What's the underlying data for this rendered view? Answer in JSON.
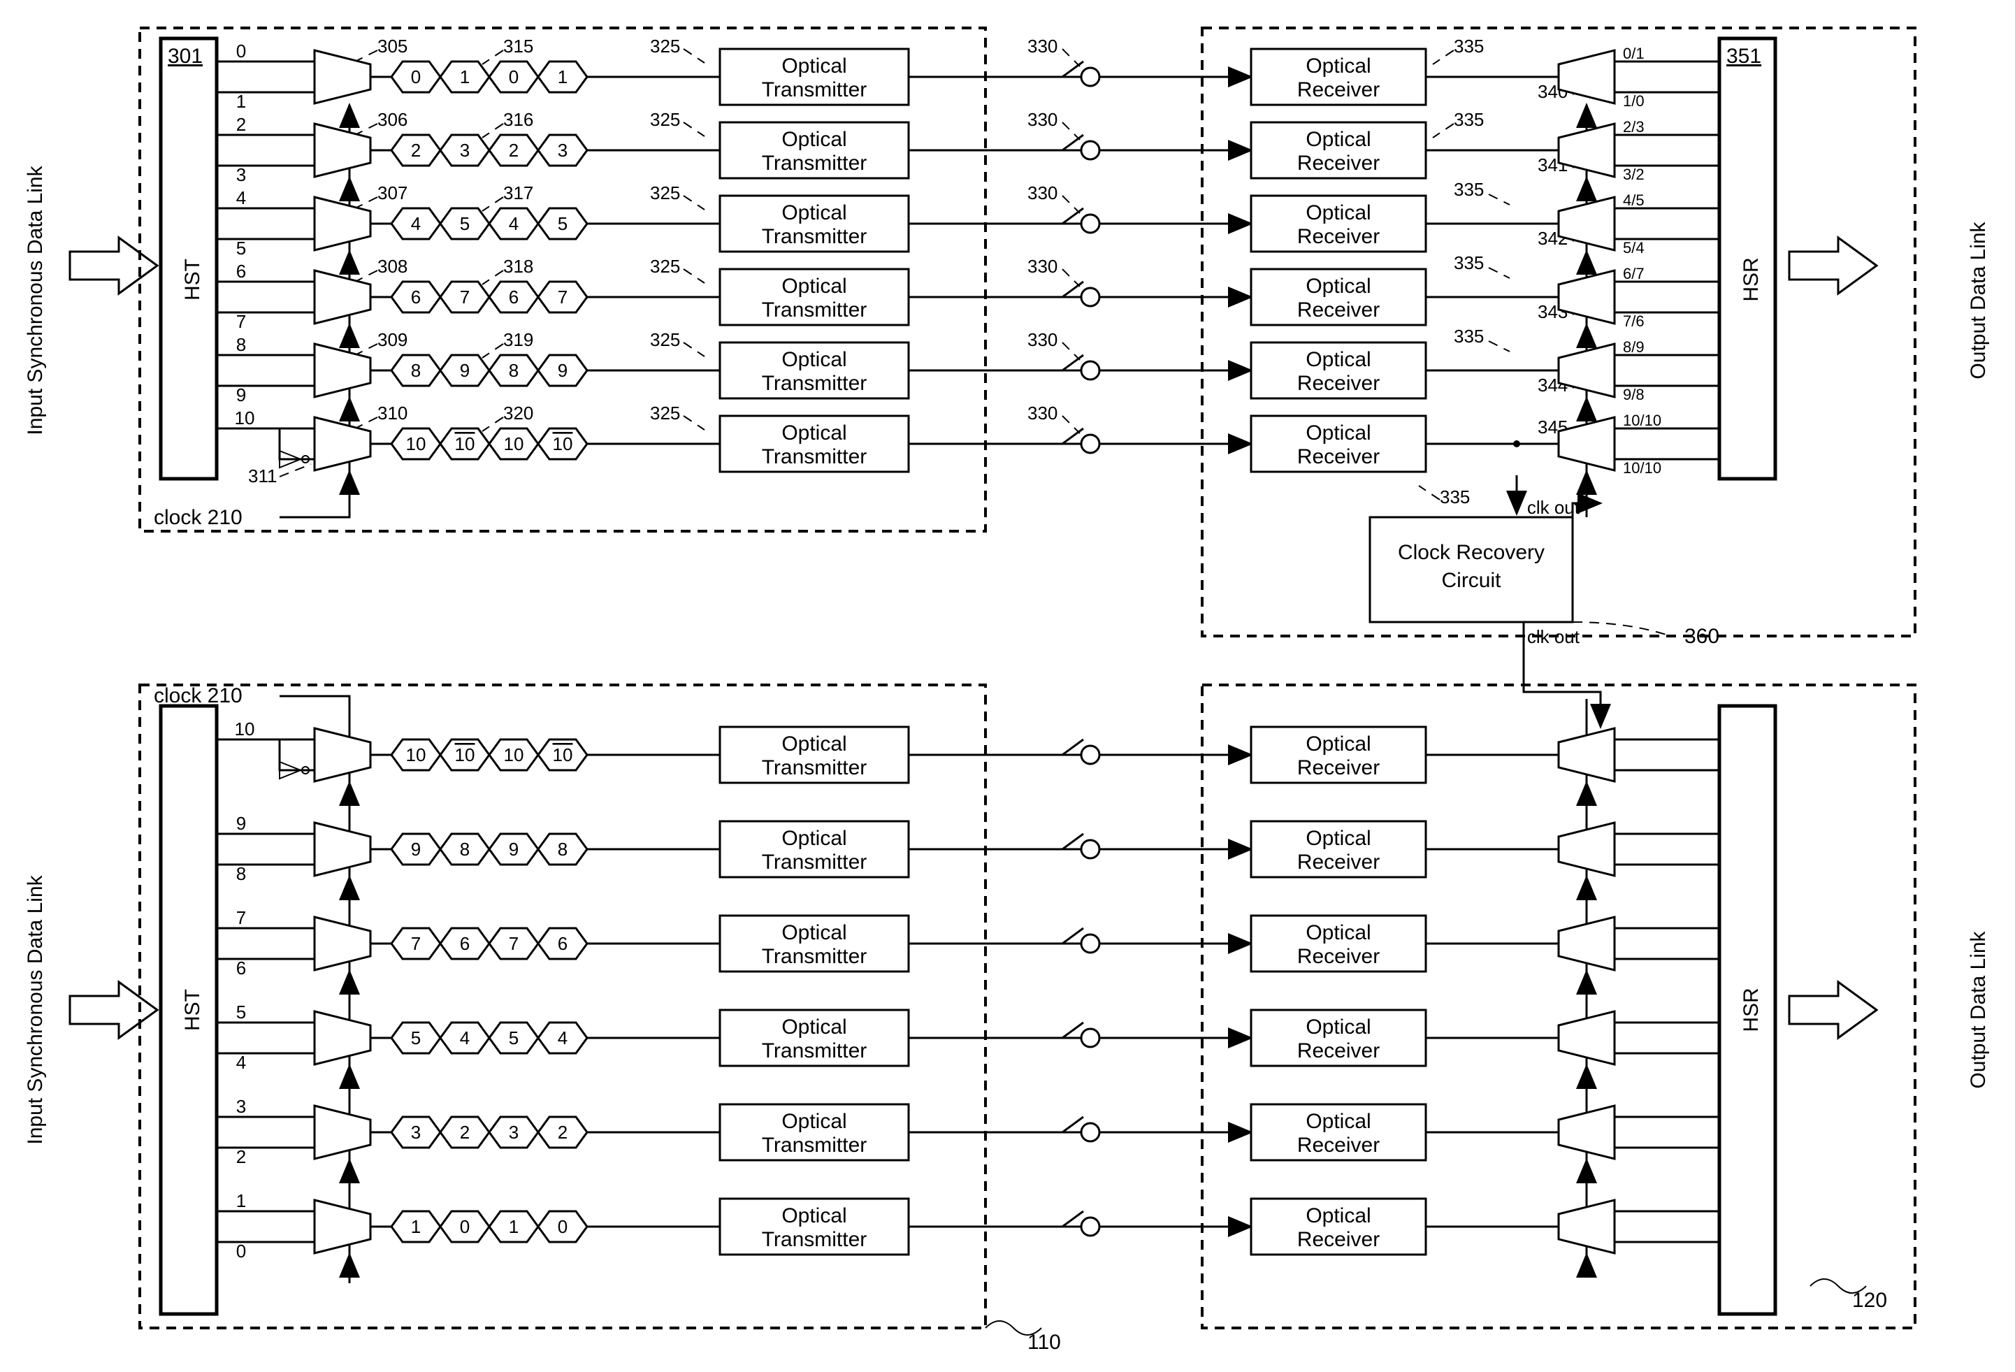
{
  "labels": {
    "input_link": "Input Synchronous Data Link",
    "output_link": "Output Data Link",
    "hst": "HST",
    "hsr": "HSR",
    "opt_tx": "Optical",
    "opt_tx2": "Transmitter",
    "opt_rx": "Optical",
    "opt_rx2": "Receiver",
    "clock": "clock 210",
    "clock_recovery1": "Clock Recovery",
    "clock_recovery2": "Circuit",
    "clk_out": "clk out"
  },
  "refs": {
    "r301": "301",
    "r351": "351",
    "r305": "305",
    "r306": "306",
    "r307": "307",
    "r308": "308",
    "r309": "309",
    "r310": "310",
    "r311": "311",
    "r315": "315",
    "r316": "316",
    "r317": "317",
    "r318": "318",
    "r319": "319",
    "r320": "320",
    "r325": "325",
    "r330": "330",
    "r335": "335",
    "r340": "340",
    "r341": "341",
    "r342": "342",
    "r343": "343",
    "r344": "344",
    "r345": "345",
    "r360": "360",
    "r110": "110",
    "r120": "120"
  },
  "channels_top": [
    {
      "in": [
        "0",
        "1"
      ],
      "hex": [
        "0",
        "1",
        "0",
        "1"
      ],
      "out": [
        "0/1",
        "1/0"
      ]
    },
    {
      "in": [
        "2",
        "3"
      ],
      "hex": [
        "2",
        "3",
        "2",
        "3"
      ],
      "out": [
        "2/3",
        "3/2"
      ]
    },
    {
      "in": [
        "4",
        "5"
      ],
      "hex": [
        "4",
        "5",
        "4",
        "5"
      ],
      "out": [
        "4/5",
        "5/4"
      ]
    },
    {
      "in": [
        "6",
        "7"
      ],
      "hex": [
        "6",
        "7",
        "6",
        "7"
      ],
      "out": [
        "6/7",
        "7/6"
      ]
    },
    {
      "in": [
        "8",
        "9"
      ],
      "hex": [
        "8",
        "9",
        "8",
        "9"
      ],
      "out": [
        "8/9",
        "9/8"
      ]
    },
    {
      "in": [
        "10"
      ],
      "hex": [
        "10",
        "10",
        "10",
        "10"
      ],
      "out": [
        "10/10",
        "10/10"
      ],
      "overline": [
        false,
        true,
        false,
        true
      ]
    }
  ],
  "channels_bot": [
    {
      "in": [
        "10"
      ],
      "hex": [
        "10",
        "10",
        "10",
        "10"
      ],
      "overline": [
        false,
        true,
        false,
        true
      ]
    },
    {
      "in": [
        "9",
        "8"
      ],
      "hex": [
        "9",
        "8",
        "9",
        "8"
      ]
    },
    {
      "in": [
        "7",
        "6"
      ],
      "hex": [
        "7",
        "6",
        "7",
        "6"
      ]
    },
    {
      "in": [
        "5",
        "4"
      ],
      "hex": [
        "5",
        "4",
        "5",
        "4"
      ]
    },
    {
      "in": [
        "3",
        "2"
      ],
      "hex": [
        "3",
        "2",
        "3",
        "2"
      ]
    },
    {
      "in": [
        "1",
        "0"
      ],
      "hex": [
        "1",
        "0",
        "1",
        "0"
      ]
    }
  ]
}
